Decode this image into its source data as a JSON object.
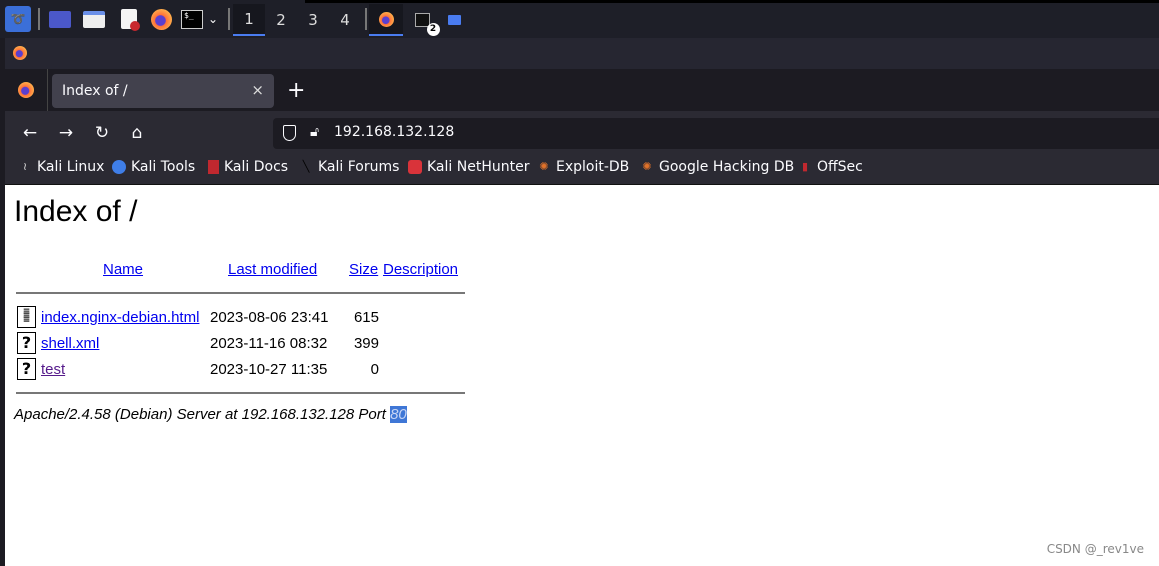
{
  "taskbar": {
    "workspaces": [
      "1",
      "2",
      "3",
      "4"
    ],
    "active_workspace": "1",
    "terminal_badge": "2",
    "icons": [
      "kali-menu-icon",
      "desktop-icon",
      "file-manager-icon",
      "text-editor-icon",
      "firefox-icon",
      "terminal-icon",
      "chevron-down-icon",
      "firefox-window-icon",
      "terminal-window-icon",
      "home-folder-icon"
    ]
  },
  "browser": {
    "tab": {
      "title": "Index of /",
      "close": "×"
    },
    "new_tab": "+",
    "nav": {
      "back": "←",
      "forward": "→",
      "reload": "↻",
      "home": "⌂"
    },
    "url": "192.168.132.128",
    "bookmarks": [
      {
        "label": "Kali Linux",
        "icon": "kali-dragon-icon",
        "color": "#dddddd"
      },
      {
        "label": "Kali Tools",
        "icon": "kali-tools-icon",
        "color": "#3f7ee8"
      },
      {
        "label": "Kali Docs",
        "icon": "kali-docs-icon",
        "color": "#c0282f"
      },
      {
        "label": "Kali Forums",
        "icon": "kali-forums-icon",
        "color": "#222222"
      },
      {
        "label": "Kali NetHunter",
        "icon": "nethunter-icon",
        "color": "#d9333a"
      },
      {
        "label": "Exploit-DB",
        "icon": "exploit-db-icon",
        "color": "#e0722a"
      },
      {
        "label": "Google Hacking DB",
        "icon": "ghdb-icon",
        "color": "#e0722a"
      },
      {
        "label": "OffSec",
        "icon": "offsec-icon",
        "color": "#c0282f"
      }
    ]
  },
  "page": {
    "title": "Index of /",
    "headers": {
      "name": "Name",
      "last_modified": "Last modified",
      "size": "Size",
      "description": "Description"
    },
    "rows": [
      {
        "icon": "text-file-icon",
        "name": "index.nginx-debian.html",
        "modified": "2023-08-06 23:41",
        "size": "615",
        "description": ""
      },
      {
        "icon": "unknown-file-icon",
        "name": "shell.xml",
        "modified": "2023-11-16 08:32",
        "size": "399",
        "description": ""
      },
      {
        "icon": "unknown-file-icon",
        "name": "test",
        "modified": "2023-10-27 11:35",
        "size": "0",
        "description": ""
      }
    ],
    "address_prefix": "Apache/2.4.58 (Debian) Server at 192.168.132.128 Port ",
    "address_port": "80"
  },
  "watermark": "CSDN @_rev1ve"
}
